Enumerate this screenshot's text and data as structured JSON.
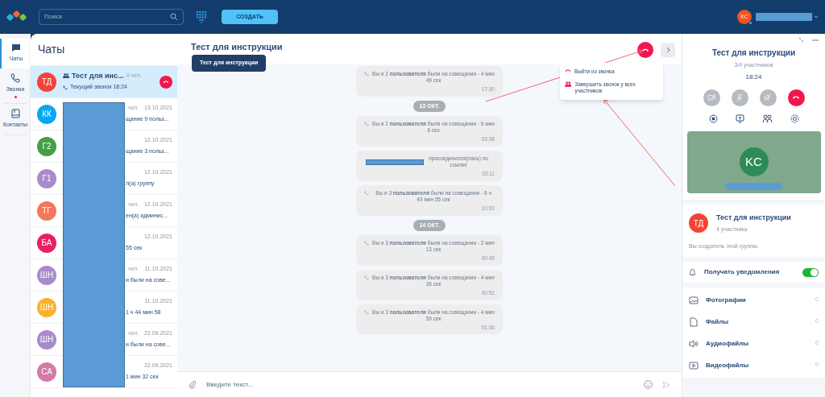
{
  "topbar": {
    "search": {
      "placeholder": "Поиск"
    },
    "create_button": "СОЗДАТЬ",
    "user": {
      "initials": "KC",
      "color": "#f4511e",
      "online": true
    }
  },
  "nav": [
    {
      "label": "Чаты",
      "selected": true,
      "badge": false
    },
    {
      "label": "Звонки",
      "selected": false,
      "badge": true
    },
    {
      "label": "Контакты",
      "selected": false,
      "badge": false
    }
  ],
  "chats": {
    "title": "Чаты",
    "items": [
      {
        "initials": "ТД",
        "color": "#f44336",
        "selected": true,
        "name": "Тест для инс...",
        "members": "4 чел.",
        "preview": "Текущий звонок 18:24",
        "in_call": true
      },
      {
        "initials": "КК",
        "color": "#03a9f4",
        "selected": false,
        "members": "чел.",
        "date": "13.10.2021",
        "preview": "щание 9 польз...",
        "in_call": false
      },
      {
        "initials": "Г2",
        "color": "#43a047",
        "selected": false,
        "date": "12.10.2021",
        "preview": "щание 3 польз...",
        "in_call": false
      },
      {
        "initials": "Г1",
        "color": "#a98bc9",
        "selected": false,
        "date": "12.10.2021",
        "preview": "л(а) группу",
        "in_call": false
      },
      {
        "initials": "ТГ",
        "color": "#f4775a",
        "selected": false,
        "members": "чел.",
        "date": "12.10.2021",
        "preview": "ен(а) админис...",
        "in_call": false
      },
      {
        "initials": "БА",
        "color": "#e91e63",
        "selected": false,
        "date": "12.10.2021",
        "preview": "55 сек",
        "in_call": false
      },
      {
        "initials": "ШН",
        "color": "#a98bc9",
        "selected": false,
        "members": "чел.",
        "date": "11.10.2021",
        "preview": "и были на сове...",
        "in_call": false
      },
      {
        "initials": "ШН",
        "color": "#fbb02d",
        "selected": false,
        "date": "11.10.2021",
        "preview": "1 ч  44 мин  58",
        "in_call": false
      },
      {
        "initials": "ШН",
        "color": "#a98bc9",
        "selected": false,
        "members": "чел.",
        "date": "23.09.2021",
        "preview": "и были на сове...",
        "in_call": false
      },
      {
        "initials": "СА",
        "color": "#d579a8",
        "selected": false,
        "date": "22.09.2021",
        "preview": "1 мин  32 сек",
        "in_call": false
      }
    ]
  },
  "conversation": {
    "title": "Тест для инструкции",
    "tooltip": "Тест для инструкции",
    "menu": [
      "Выйти из звонка",
      "Завершить звонок у всех участников"
    ],
    "messages": [
      {
        "kind": "call",
        "text": "Вы и 2 **пользователя** были на совещании - 4 мин 49 сек",
        "time": "17:30"
      },
      {
        "kind": "date",
        "text": "13 ОКТ."
      },
      {
        "kind": "call",
        "text": "Вы и 2 **пользователя** были на совещании - 6 мин 6 сек",
        "time": "03:08"
      },
      {
        "kind": "joined",
        "text": "присоединился(лась) по ссылке",
        "time": "03:11"
      },
      {
        "kind": "call",
        "text": "Вы и 3 **пользователя** были на совещании - 6 ч 49 мин 55 сек",
        "time": "10:00"
      },
      {
        "kind": "date",
        "text": "14 ОКТ."
      },
      {
        "kind": "call",
        "text": "Вы и 3 **пользователя** были на совещании - 2 мин 13 сек",
        "time": "00:45"
      },
      {
        "kind": "call",
        "text": "Вы и 3 **пользователя** были на совещании - 4 мин 26 сек",
        "time": "00:51"
      },
      {
        "kind": "call",
        "text": "Вы и 3 **пользователя** были на совещании - 4 мин 59 сек",
        "time": "01:06"
      }
    ],
    "input": {
      "placeholder": "Введите текст..."
    }
  },
  "call_panel": {
    "title": "Тест для инструкции",
    "participants": "3/4 участников",
    "duration": "18:24",
    "controls": [
      {
        "kind": "camera",
        "on": false
      },
      {
        "kind": "mic",
        "on": false
      },
      {
        "kind": "speaker",
        "on": false
      },
      {
        "kind": "hangup",
        "on": true
      }
    ],
    "tile": {
      "initials": "KC"
    }
  },
  "group": {
    "initials": "ТД",
    "color": "#f44336",
    "name": "Тест для инструкции",
    "members": "4 участника",
    "note": "Вы создатель этой группы",
    "notifications": {
      "label": "Получать уведомления",
      "on": true
    },
    "media": [
      {
        "kind": "photo",
        "label": "Фотографии",
        "count": "0"
      },
      {
        "kind": "file",
        "label": "Файлы",
        "count": "0"
      },
      {
        "kind": "audio",
        "label": "Аудиофайлы",
        "count": "0"
      },
      {
        "kind": "video",
        "label": "Видеофайлы",
        "count": "0"
      }
    ]
  }
}
